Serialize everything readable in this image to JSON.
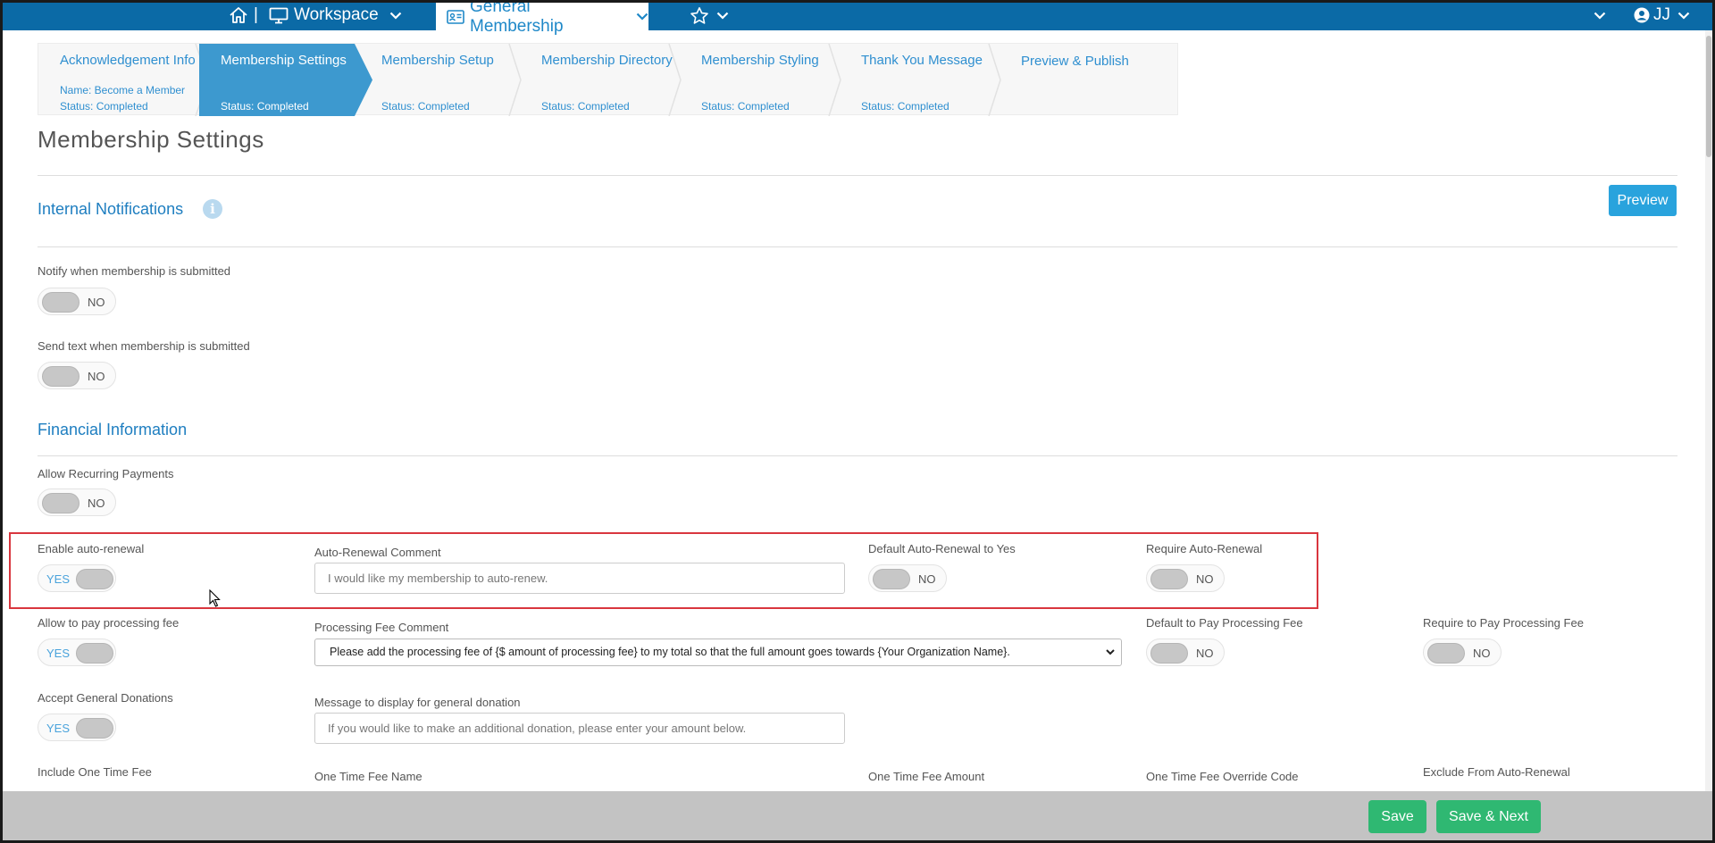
{
  "topbar": {
    "sep": "|",
    "workspace": "Workspace",
    "current_form": "General Membership",
    "user_initials": "JJ"
  },
  "wizard": {
    "steps": [
      {
        "title": "Acknowledgement Info",
        "name": "Name: Become a Member",
        "status": "Status: Completed"
      },
      {
        "title": "Membership Settings",
        "status": "Status: Completed"
      },
      {
        "title": "Membership Setup",
        "status": "Status: Completed"
      },
      {
        "title": "Membership Directory",
        "status": "Status: Completed"
      },
      {
        "title": "Membership Styling",
        "status": "Status: Completed"
      },
      {
        "title": "Thank You Message",
        "status": "Status: Completed"
      },
      {
        "title": "Preview & Publish"
      }
    ]
  },
  "page": {
    "title": "Membership Settings",
    "preview_label": "Preview"
  },
  "internal": {
    "title": "Internal Notifications",
    "notify_label": "Notify when membership is submitted",
    "notify_value": "NO",
    "text_label": "Send text when membership is submitted",
    "text_value": "NO"
  },
  "financial": {
    "title": "Financial Information",
    "recurring_label": "Allow Recurring Payments",
    "recurring_value": "NO",
    "auto_renewal_label": "Enable auto-renewal",
    "auto_renewal_value": "YES",
    "auto_comment_label": "Auto-Renewal Comment",
    "auto_comment_placeholder": "I would like my membership to auto-renew.",
    "default_auto_label": "Default Auto-Renewal to Yes",
    "default_auto_value": "NO",
    "require_auto_label": "Require Auto-Renewal",
    "require_auto_value": "NO",
    "proc_fee_label": "Allow to pay processing fee",
    "proc_fee_value": "YES",
    "proc_comment_label": "Processing Fee Comment",
    "proc_comment_value": "Please add the processing fee of {$ amount of processing fee} to my total so that the full amount goes towards {Your Organization Name}.",
    "default_proc_label": "Default to Pay Processing Fee",
    "default_proc_value": "NO",
    "require_proc_label": "Require to Pay Processing Fee",
    "require_proc_value": "NO",
    "donations_label": "Accept General Donations",
    "donations_value": "YES",
    "donation_msg_label": "Message to display for general donation",
    "donation_msg_placeholder": "If you would like to make an additional donation, please enter your amount below.",
    "one_time_label": "Include One Time Fee",
    "one_time_name_label": "One Time Fee Name",
    "one_time_amount_label": "One Time Fee Amount",
    "one_time_override_label": "One Time Fee Override Code",
    "exclude_label": "Exclude From Auto-Renewal"
  },
  "footer": {
    "save_label": "Save",
    "save_next_label": "Save & Next"
  }
}
